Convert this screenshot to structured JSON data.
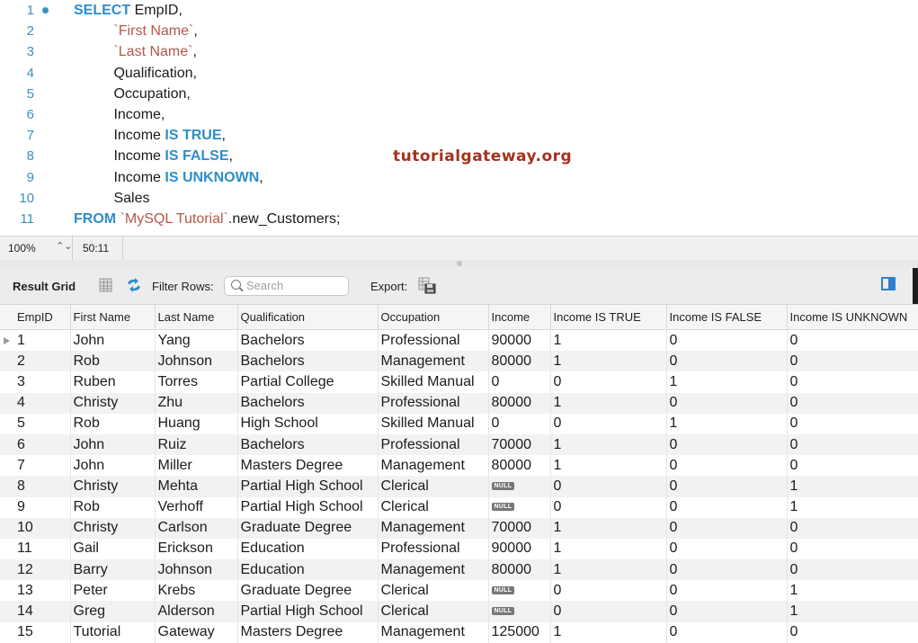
{
  "editor": {
    "lines": [
      {
        "n": "1",
        "parts": [
          {
            "t": "SELECT",
            "c": "kw"
          },
          {
            "t": " EmpID,",
            "c": ""
          }
        ]
      },
      {
        "n": "2",
        "parts": [
          {
            "t": "          ",
            "c": ""
          },
          {
            "t": "`First Name`",
            "c": "str"
          },
          {
            "t": ",",
            "c": ""
          }
        ]
      },
      {
        "n": "3",
        "parts": [
          {
            "t": "          ",
            "c": ""
          },
          {
            "t": "`Last Name`",
            "c": "str"
          },
          {
            "t": ",",
            "c": ""
          }
        ]
      },
      {
        "n": "4",
        "parts": [
          {
            "t": "          Qualification,",
            "c": ""
          }
        ]
      },
      {
        "n": "5",
        "parts": [
          {
            "t": "          Occupation,",
            "c": ""
          }
        ]
      },
      {
        "n": "6",
        "parts": [
          {
            "t": "          Income,",
            "c": ""
          }
        ]
      },
      {
        "n": "7",
        "parts": [
          {
            "t": "          Income ",
            "c": ""
          },
          {
            "t": "IS TRUE",
            "c": "kw"
          },
          {
            "t": ",",
            "c": ""
          }
        ]
      },
      {
        "n": "8",
        "parts": [
          {
            "t": "          Income ",
            "c": ""
          },
          {
            "t": "IS FALSE",
            "c": "kw"
          },
          {
            "t": ",",
            "c": ""
          }
        ]
      },
      {
        "n": "9",
        "parts": [
          {
            "t": "          Income ",
            "c": ""
          },
          {
            "t": "IS UNKNOWN",
            "c": "kw"
          },
          {
            "t": ",",
            "c": ""
          }
        ]
      },
      {
        "n": "10",
        "parts": [
          {
            "t": "          Sales",
            "c": ""
          }
        ]
      },
      {
        "n": "11",
        "parts": [
          {
            "t": "FROM",
            "c": "kw"
          },
          {
            "t": " ",
            "c": ""
          },
          {
            "t": "`MySQL Tutorial`",
            "c": "str"
          },
          {
            "t": ".new_Customers;",
            "c": ""
          }
        ]
      }
    ],
    "watermark": "tutorialgateway.org"
  },
  "status": {
    "zoom": "100%",
    "zoom_step": "⌃⌄",
    "cursor": "50:11"
  },
  "toolbar": {
    "title": "Result Grid",
    "filter_label": "Filter Rows:",
    "search_placeholder": "Search",
    "export_label": "Export:"
  },
  "grid": {
    "columns": [
      "EmpID",
      "First Name",
      "Last Name",
      "Qualification",
      "Occupation",
      "Income",
      "Income IS TRUE",
      "Income IS FALSE",
      "Income IS UNKNOWN"
    ],
    "rows": [
      [
        "1",
        "John",
        "Yang",
        "Bachelors",
        "Professional",
        "90000",
        "1",
        "0",
        "0"
      ],
      [
        "2",
        "Rob",
        "Johnson",
        "Bachelors",
        "Management",
        "80000",
        "1",
        "0",
        "0"
      ],
      [
        "3",
        "Ruben",
        "Torres",
        "Partial College",
        "Skilled Manual",
        "0",
        "0",
        "1",
        "0"
      ],
      [
        "4",
        "Christy",
        "Zhu",
        "Bachelors",
        "Professional",
        "80000",
        "1",
        "0",
        "0"
      ],
      [
        "5",
        "Rob",
        "Huang",
        "High School",
        "Skilled Manual",
        "0",
        "0",
        "1",
        "0"
      ],
      [
        "6",
        "John",
        "Ruiz",
        "Bachelors",
        "Professional",
        "70000",
        "1",
        "0",
        "0"
      ],
      [
        "7",
        "John",
        "Miller",
        "Masters Degree",
        "Management",
        "80000",
        "1",
        "0",
        "0"
      ],
      [
        "8",
        "Christy",
        "Mehta",
        "Partial High School",
        "Clerical",
        "NULL",
        "0",
        "0",
        "1"
      ],
      [
        "9",
        "Rob",
        "Verhoff",
        "Partial High School",
        "Clerical",
        "NULL",
        "0",
        "0",
        "1"
      ],
      [
        "10",
        "Christy",
        "Carlson",
        "Graduate Degree",
        "Management",
        "70000",
        "1",
        "0",
        "0"
      ],
      [
        "11",
        "Gail",
        "Erickson",
        "Education",
        "Professional",
        "90000",
        "1",
        "0",
        "0"
      ],
      [
        "12",
        "Barry",
        "Johnson",
        "Education",
        "Management",
        "80000",
        "1",
        "0",
        "0"
      ],
      [
        "13",
        "Peter",
        "Krebs",
        "Graduate Degree",
        "Clerical",
        "NULL",
        "0",
        "0",
        "1"
      ],
      [
        "14",
        "Greg",
        "Alderson",
        "Partial High School",
        "Clerical",
        "NULL",
        "0",
        "0",
        "1"
      ],
      [
        "15",
        "Tutorial",
        "Gateway",
        "Masters Degree",
        "Management",
        "125000",
        "1",
        "0",
        "0"
      ]
    ]
  },
  "colors": {
    "keyword": "#2e8ec9",
    "string": "#b3584a",
    "watermark": "#a3321e",
    "accent": "#2e7fd0"
  }
}
